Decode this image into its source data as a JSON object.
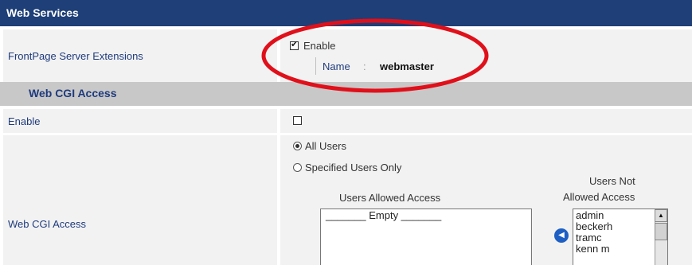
{
  "header": {
    "title": "Web Services"
  },
  "frontpage": {
    "label": "FrontPage Server Extensions",
    "enable_checked": true,
    "enable_label": "Enable",
    "name_label": "Name",
    "name_separator": ":",
    "name_value": "webmaster"
  },
  "cgi_section": {
    "title": "Web CGI Access"
  },
  "cgi_enable": {
    "label": "Enable",
    "checked": false
  },
  "cgi_access": {
    "label": "Web CGI Access",
    "options": [
      {
        "label": "All Users",
        "selected": true
      },
      {
        "label": "Specified Users Only",
        "selected": false
      }
    ],
    "allowed_title": "Users Allowed Access",
    "allowed_placeholder": "_______ Empty _______",
    "not_allowed_title_line1": "Users Not",
    "not_allowed_title_line2": "Allowed Access",
    "not_allowed_users": [
      "admin",
      "beckerh",
      "tramc",
      "kenn m"
    ]
  },
  "colors": {
    "header_bg": "#1e3f77",
    "label_text": "#1f3b7d",
    "section_bg": "#c8c8c8",
    "annotation": "#e0101a"
  },
  "icons": {
    "move_left": "triangle-left-icon",
    "scroll_up": "triangle-up-icon"
  }
}
